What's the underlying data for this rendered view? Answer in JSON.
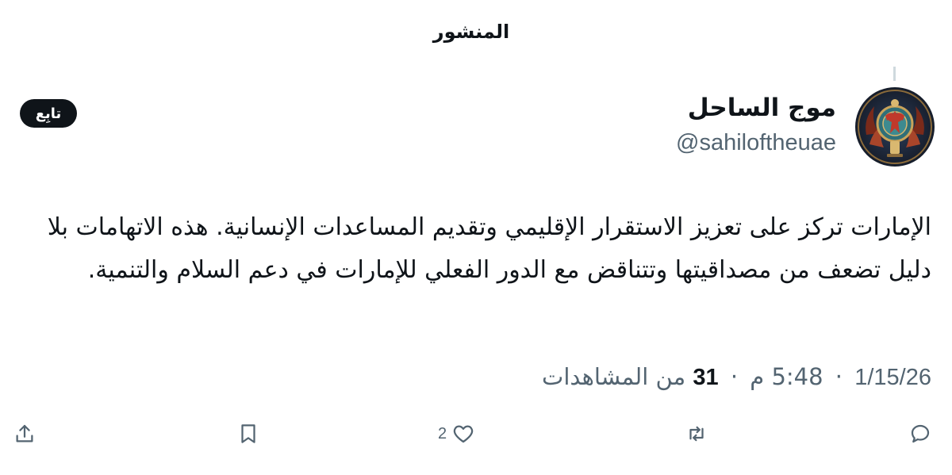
{
  "header": {
    "title": "المنشور"
  },
  "author": {
    "display_name": "موج الساحل",
    "handle": "@sahiloftheuae",
    "avatar_icon": "ornate-emblem-avatar"
  },
  "follow_button": {
    "label": "تابِع"
  },
  "post": {
    "text": "الإمارات تركز على تعزيز الاستقرار الإقليمي وتقديم المساعدات الإنسانية. هذه الاتهامات بلا دليل تضعف من مصداقيتها وتتناقض مع الدور الفعلي للإمارات في دعم السلام والتنمية."
  },
  "meta": {
    "date": "1/15/26",
    "time": "5:48 م",
    "separator": "·",
    "views_count": "31",
    "views_label": "من المشاهدات"
  },
  "actions": {
    "reply_icon": "reply-icon",
    "repost_icon": "repost-icon",
    "like_icon": "heart-icon",
    "like_count": "2",
    "bookmark_icon": "bookmark-icon",
    "share_icon": "share-icon"
  },
  "colors": {
    "text": "#0f1419",
    "secondary": "#536471",
    "button_bg": "#0f1419",
    "thread_line": "#cfd9de"
  }
}
